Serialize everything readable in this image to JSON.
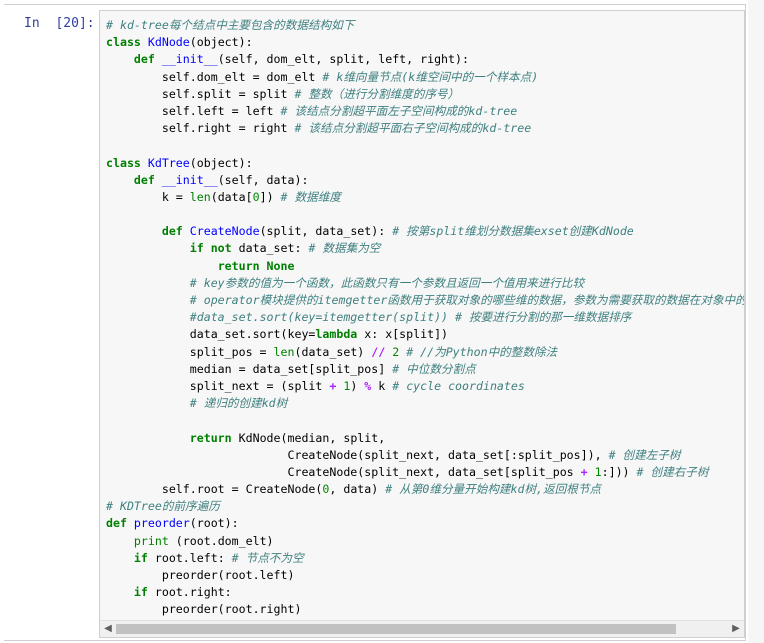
{
  "prompt": {
    "in": "In",
    "number": "[20]:"
  },
  "lines": [
    {
      "segs": [
        {
          "t": "# kd-tree每个结点中主要包含的数据结构如下",
          "c": "cm"
        }
      ]
    },
    {
      "segs": [
        {
          "t": "class ",
          "c": "kw"
        },
        {
          "t": "KdNode",
          "c": "def"
        },
        {
          "t": "(object):",
          "c": ""
        }
      ]
    },
    {
      "segs": [
        {
          "t": "    ",
          "c": ""
        },
        {
          "t": "def ",
          "c": "kw"
        },
        {
          "t": "__init__",
          "c": "def"
        },
        {
          "t": "(self, dom_elt, split, left, right):",
          "c": ""
        }
      ]
    },
    {
      "segs": [
        {
          "t": "        self.dom_elt = dom_elt ",
          "c": ""
        },
        {
          "t": "# k维向量节点(k维空间中的一个样本点)",
          "c": "cm"
        }
      ]
    },
    {
      "segs": [
        {
          "t": "        self.split = split ",
          "c": ""
        },
        {
          "t": "# 整数（进行分割维度的序号）",
          "c": "cm"
        }
      ]
    },
    {
      "segs": [
        {
          "t": "        self.left = left ",
          "c": ""
        },
        {
          "t": "# 该结点分割超平面左子空间构成的kd-tree",
          "c": "cm"
        }
      ]
    },
    {
      "segs": [
        {
          "t": "        self.right = right ",
          "c": ""
        },
        {
          "t": "# 该结点分割超平面右子空间构成的kd-tree",
          "c": "cm"
        }
      ]
    },
    {
      "segs": [
        {
          "t": "",
          "c": ""
        }
      ]
    },
    {
      "segs": [
        {
          "t": "class ",
          "c": "kw"
        },
        {
          "t": "KdTree",
          "c": "def"
        },
        {
          "t": "(object):",
          "c": ""
        }
      ]
    },
    {
      "segs": [
        {
          "t": "    ",
          "c": ""
        },
        {
          "t": "def ",
          "c": "kw"
        },
        {
          "t": "__init__",
          "c": "def"
        },
        {
          "t": "(self, data):",
          "c": ""
        }
      ]
    },
    {
      "segs": [
        {
          "t": "        k = ",
          "c": ""
        },
        {
          "t": "len",
          "c": "nm"
        },
        {
          "t": "(data[",
          "c": ""
        },
        {
          "t": "0",
          "c": "num"
        },
        {
          "t": "]) ",
          "c": ""
        },
        {
          "t": "# 数据维度",
          "c": "cm"
        }
      ]
    },
    {
      "segs": [
        {
          "t": "",
          "c": ""
        }
      ]
    },
    {
      "segs": [
        {
          "t": "        ",
          "c": ""
        },
        {
          "t": "def ",
          "c": "kw"
        },
        {
          "t": "CreateNode",
          "c": "def"
        },
        {
          "t": "(split, data_set): ",
          "c": ""
        },
        {
          "t": "# 按第split维划分数据集exset创建KdNode",
          "c": "cm"
        }
      ]
    },
    {
      "segs": [
        {
          "t": "            ",
          "c": ""
        },
        {
          "t": "if not ",
          "c": "kw"
        },
        {
          "t": "data_set: ",
          "c": ""
        },
        {
          "t": "# 数据集为空",
          "c": "cm"
        }
      ]
    },
    {
      "segs": [
        {
          "t": "                ",
          "c": ""
        },
        {
          "t": "return None",
          "c": "kw"
        }
      ]
    },
    {
      "segs": [
        {
          "t": "            ",
          "c": ""
        },
        {
          "t": "# key参数的值为一个函数，此函数只有一个参数且返回一个值用来进行比较",
          "c": "cm"
        }
      ]
    },
    {
      "segs": [
        {
          "t": "            ",
          "c": ""
        },
        {
          "t": "# operator模块提供的itemgetter函数用于获取对象的哪些维的数据，参数为需要获取的数据在对象中的序号",
          "c": "cm"
        }
      ]
    },
    {
      "segs": [
        {
          "t": "            ",
          "c": ""
        },
        {
          "t": "#data_set.sort(key=itemgetter(split)) # 按要进行分割的那一维数据排序",
          "c": "cm"
        }
      ]
    },
    {
      "segs": [
        {
          "t": "            data_set.sort(key=",
          "c": ""
        },
        {
          "t": "lambda ",
          "c": "kw"
        },
        {
          "t": "x: x[split])",
          "c": ""
        }
      ]
    },
    {
      "segs": [
        {
          "t": "            split_pos = ",
          "c": ""
        },
        {
          "t": "len",
          "c": "nm"
        },
        {
          "t": "(data_set) ",
          "c": ""
        },
        {
          "t": "//",
          "c": "op"
        },
        {
          "t": " ",
          "c": ""
        },
        {
          "t": "2",
          "c": "num"
        },
        {
          "t": " ",
          "c": ""
        },
        {
          "t": "# //为Python中的整数除法",
          "c": "cm"
        }
      ]
    },
    {
      "segs": [
        {
          "t": "            median = data_set[split_pos] ",
          "c": ""
        },
        {
          "t": "# 中位数分割点",
          "c": "cm"
        }
      ]
    },
    {
      "segs": [
        {
          "t": "            split_next = (split ",
          "c": ""
        },
        {
          "t": "+",
          "c": "op"
        },
        {
          "t": " ",
          "c": ""
        },
        {
          "t": "1",
          "c": "num"
        },
        {
          "t": ") ",
          "c": ""
        },
        {
          "t": "%",
          "c": "op"
        },
        {
          "t": " k ",
          "c": ""
        },
        {
          "t": "# cycle coordinates",
          "c": "cm"
        }
      ]
    },
    {
      "segs": [
        {
          "t": "            ",
          "c": ""
        },
        {
          "t": "# 递归的创建kd树",
          "c": "cm"
        }
      ]
    },
    {
      "segs": [
        {
          "t": "",
          "c": ""
        }
      ]
    },
    {
      "segs": [
        {
          "t": "            ",
          "c": ""
        },
        {
          "t": "return ",
          "c": "kw"
        },
        {
          "t": "KdNode(median, split,",
          "c": ""
        }
      ]
    },
    {
      "segs": [
        {
          "t": "                          CreateNode(split_next, data_set[:split_pos]), ",
          "c": ""
        },
        {
          "t": "# 创建左子树",
          "c": "cm"
        }
      ]
    },
    {
      "segs": [
        {
          "t": "                          CreateNode(split_next, data_set[split_pos ",
          "c": ""
        },
        {
          "t": "+",
          "c": "op"
        },
        {
          "t": " ",
          "c": ""
        },
        {
          "t": "1",
          "c": "num"
        },
        {
          "t": ":])) ",
          "c": ""
        },
        {
          "t": "# 创建右子树",
          "c": "cm"
        }
      ]
    },
    {
      "segs": [
        {
          "t": "        self.root = CreateNode(",
          "c": ""
        },
        {
          "t": "0",
          "c": "num"
        },
        {
          "t": ", data) ",
          "c": ""
        },
        {
          "t": "# 从第0维分量开始构建kd树,返回根节点",
          "c": "cm"
        }
      ]
    },
    {
      "segs": [
        {
          "t": "# KDTree的前序遍历",
          "c": "cm"
        }
      ]
    },
    {
      "segs": [
        {
          "t": "def ",
          "c": "kw"
        },
        {
          "t": "preorder",
          "c": "def"
        },
        {
          "t": "(root):",
          "c": ""
        }
      ]
    },
    {
      "segs": [
        {
          "t": "    ",
          "c": ""
        },
        {
          "t": "print",
          "c": "nm"
        },
        {
          "t": " (root.dom_elt)",
          "c": ""
        }
      ]
    },
    {
      "segs": [
        {
          "t": "    ",
          "c": ""
        },
        {
          "t": "if ",
          "c": "kw"
        },
        {
          "t": "root.left: ",
          "c": ""
        },
        {
          "t": "# 节点不为空",
          "c": "cm"
        }
      ]
    },
    {
      "segs": [
        {
          "t": "        preorder(root.left)",
          "c": ""
        }
      ]
    },
    {
      "segs": [
        {
          "t": "    ",
          "c": ""
        },
        {
          "t": "if ",
          "c": "kw"
        },
        {
          "t": "root.right:",
          "c": ""
        }
      ]
    },
    {
      "segs": [
        {
          "t": "        preorder(root.right)",
          "c": ""
        }
      ]
    }
  ],
  "scrollbar": {
    "left_arrow": "◀",
    "right_arrow": "▶"
  }
}
